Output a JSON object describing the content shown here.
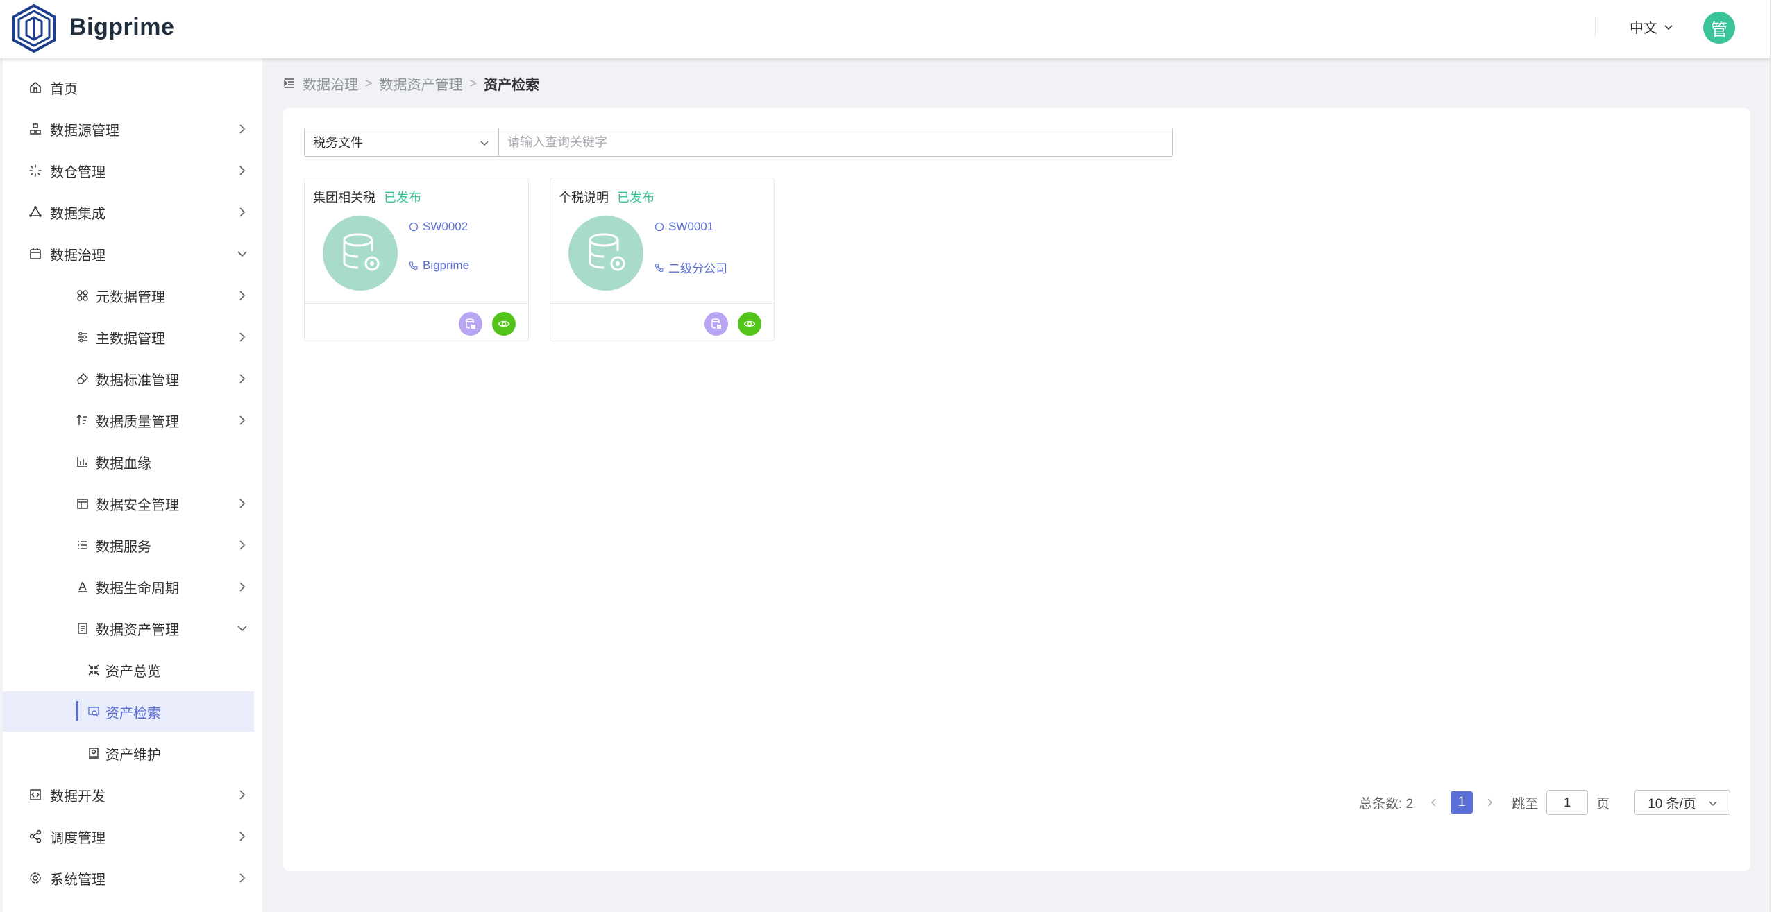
{
  "app": {
    "name": "Bigprime"
  },
  "header": {
    "language": "中文",
    "avatar_text": "管"
  },
  "sidebar": {
    "items": [
      {
        "label": "首页",
        "icon": "home-icon"
      },
      {
        "label": "数据源管理",
        "icon": "database-source-icon"
      },
      {
        "label": "数仓管理",
        "icon": "loading-icon"
      },
      {
        "label": "数据集成",
        "icon": "integration-icon"
      },
      {
        "label": "数据治理",
        "icon": "calendar-icon"
      },
      {
        "label": "元数据管理",
        "icon": "grid-icon"
      },
      {
        "label": "主数据管理",
        "icon": "sliders-icon"
      },
      {
        "label": "数据标准管理",
        "icon": "eraser-icon"
      },
      {
        "label": "数据质量管理",
        "icon": "sort-icon"
      },
      {
        "label": "数据血缘",
        "icon": "bar-chart-icon"
      },
      {
        "label": "数据安全管理",
        "icon": "table-icon"
      },
      {
        "label": "数据服务",
        "icon": "list-icon"
      },
      {
        "label": "数据生命周期",
        "icon": "lifecycle-icon"
      },
      {
        "label": "数据资产管理",
        "icon": "document-icon"
      },
      {
        "label": "资产总览",
        "icon": "shrink-icon"
      },
      {
        "label": "资产检索",
        "icon": "search-card-icon"
      },
      {
        "label": "资产维护",
        "icon": "maintenance-icon"
      },
      {
        "label": "数据开发",
        "icon": "code-icon"
      },
      {
        "label": "调度管理",
        "icon": "share-icon"
      },
      {
        "label": "系统管理",
        "icon": "settings-icon"
      }
    ]
  },
  "breadcrumb": {
    "items": [
      "数据治理",
      "数据资产管理",
      "资产检索"
    ]
  },
  "search": {
    "category": "税务文件",
    "placeholder": "请输入查询关键字",
    "value": ""
  },
  "cards": [
    {
      "title": "集团相关税",
      "status": "已发布",
      "code": "SW0002",
      "owner": "Bigprime"
    },
    {
      "title": "个税说明",
      "status": "已发布",
      "code": "SW0001",
      "owner": "二级分公司"
    }
  ],
  "pagination": {
    "total_label": "总条数:",
    "total": "2",
    "current_page": "1",
    "jump_label": "跳至",
    "jump_value": "1",
    "page_unit": "页",
    "page_size": "10 条/页"
  },
  "colors": {
    "accent": "#5b6fd6",
    "status_green": "#3bc39a",
    "action_purple": "#b8a6f2",
    "action_green": "#52c41a"
  }
}
